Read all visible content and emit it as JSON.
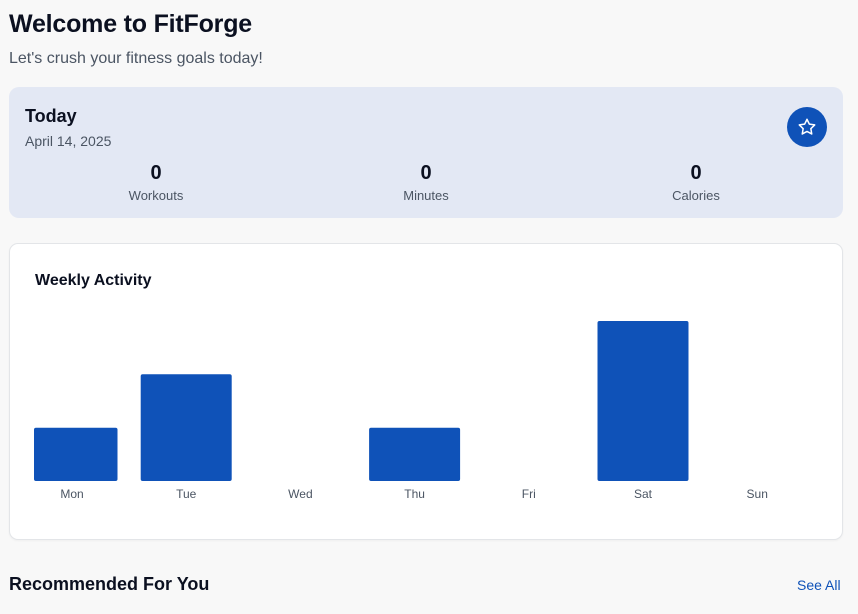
{
  "header": {
    "title": "Welcome to FitForge",
    "subtitle": "Let's crush your fitness goals today!"
  },
  "today": {
    "title": "Today",
    "date": "April 14, 2025",
    "icon": "star-icon",
    "stats": [
      {
        "value": "0",
        "label": "Workouts"
      },
      {
        "value": "0",
        "label": "Minutes"
      },
      {
        "value": "0",
        "label": "Calories"
      }
    ]
  },
  "activity": {
    "title": "Weekly Activity"
  },
  "chart_data": {
    "type": "bar",
    "categories": [
      "Mon",
      "Tue",
      "Wed",
      "Thu",
      "Fri",
      "Sat",
      "Sun"
    ],
    "values": [
      1,
      2,
      0,
      1,
      0,
      3,
      0
    ],
    "color": "#0f52b8"
  },
  "recommended": {
    "title": "Recommended For You",
    "see_all": "See All"
  },
  "colors": {
    "accent": "#0f52b8",
    "today_card_bg": "#e3e8f4",
    "page_bg": "#f8f8f8"
  }
}
